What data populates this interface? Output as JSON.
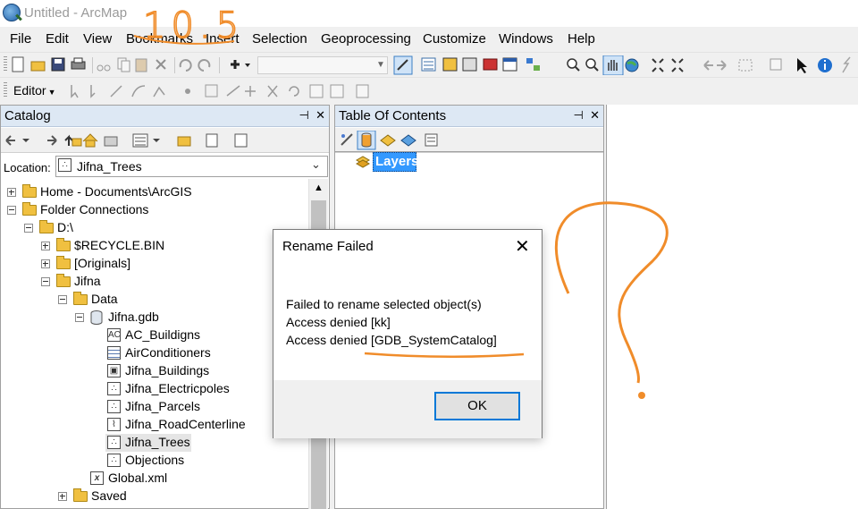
{
  "window": {
    "title": "Untitled - ArcMap"
  },
  "menu": [
    "File",
    "Edit",
    "View",
    "Bookmarks",
    "Insert",
    "Selection",
    "Geoprocessing",
    "Customize",
    "Windows",
    "Help"
  ],
  "editor_toolbar": {
    "label": "Editor"
  },
  "catalog": {
    "title": "Catalog",
    "pin": "⊣",
    "close": "✕",
    "location_label": "Location:",
    "location_value": "Jifna_Trees",
    "tree": [
      {
        "label": "Home - Documents\\ArcGIS",
        "icon": "home-folder-icon",
        "expander": "plus"
      },
      {
        "label": "Folder Connections",
        "icon": "folder-connection-icon",
        "expander": "minus"
      },
      {
        "label": "D:\\",
        "icon": "folder-open-icon",
        "expander": "minus"
      },
      {
        "label": "$RECYCLE.BIN",
        "icon": "folder-icon",
        "expander": "plus"
      },
      {
        "label": "[Originals]",
        "icon": "folder-icon",
        "expander": "plus"
      },
      {
        "label": "Jifna",
        "icon": "folder-open-icon",
        "expander": "minus"
      },
      {
        "label": "Data",
        "icon": "folder-open-icon",
        "expander": "minus"
      },
      {
        "label": "Jifna.gdb",
        "icon": "geodatabase-icon",
        "expander": "minus"
      },
      {
        "label": "AC_Buildigns",
        "icon": "annotation-class-icon",
        "expander": "none"
      },
      {
        "label": "AirConditioners",
        "icon": "table-icon",
        "expander": "none"
      },
      {
        "label": "Jifna_Buildings",
        "icon": "polygon-class-icon",
        "expander": "none"
      },
      {
        "label": "Jifna_Electricpoles",
        "icon": "point-class-icon",
        "expander": "none"
      },
      {
        "label": "Jifna_Parcels",
        "icon": "point-class-icon",
        "expander": "none"
      },
      {
        "label": "Jifna_RoadCenterline",
        "icon": "line-class-icon",
        "expander": "none"
      },
      {
        "label": "Jifna_Trees",
        "icon": "point-class-icon",
        "expander": "none"
      },
      {
        "label": "Objections",
        "icon": "point-class-icon",
        "expander": "none"
      },
      {
        "label": "Global.xml",
        "icon": "xml-file-icon",
        "expander": "none"
      },
      {
        "label": "Saved",
        "icon": "folder-icon",
        "expander": "plus"
      }
    ]
  },
  "toc": {
    "title": "Table Of Contents",
    "pin": "⊣",
    "close": "✕",
    "root": "Layers"
  },
  "dialog": {
    "title": "Rename Failed",
    "close": "✕",
    "lines": [
      "Failed to rename selected object(s)",
      "Access denied [kk]",
      "Access denied [GDB_SystemCatalog]"
    ],
    "ok_label": "OK"
  },
  "annotation": {
    "text": "10.5",
    "color": "#f08c2a"
  }
}
